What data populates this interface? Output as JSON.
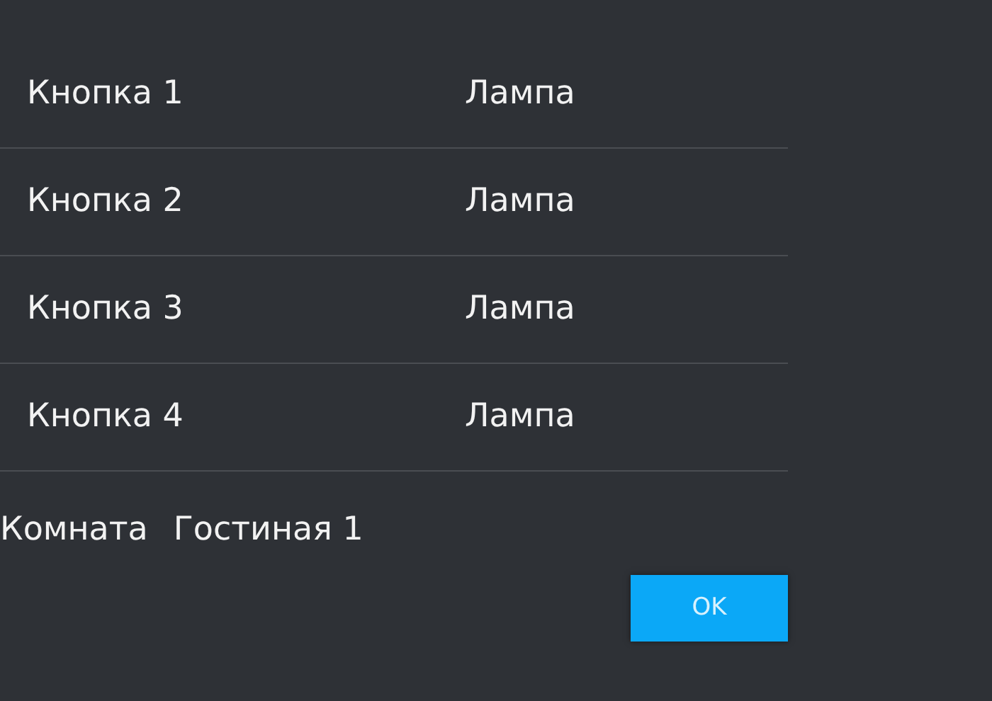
{
  "rows": [
    {
      "button": "Кнопка 1",
      "device": "Лампа"
    },
    {
      "button": "Кнопка 2",
      "device": "Лампа"
    },
    {
      "button": "Кнопка 3",
      "device": "Лампа"
    },
    {
      "button": "Кнопка 4",
      "device": "Лампа"
    }
  ],
  "room": {
    "label": "Комната",
    "value": "Гостиная 1"
  },
  "ok_button": "OK"
}
